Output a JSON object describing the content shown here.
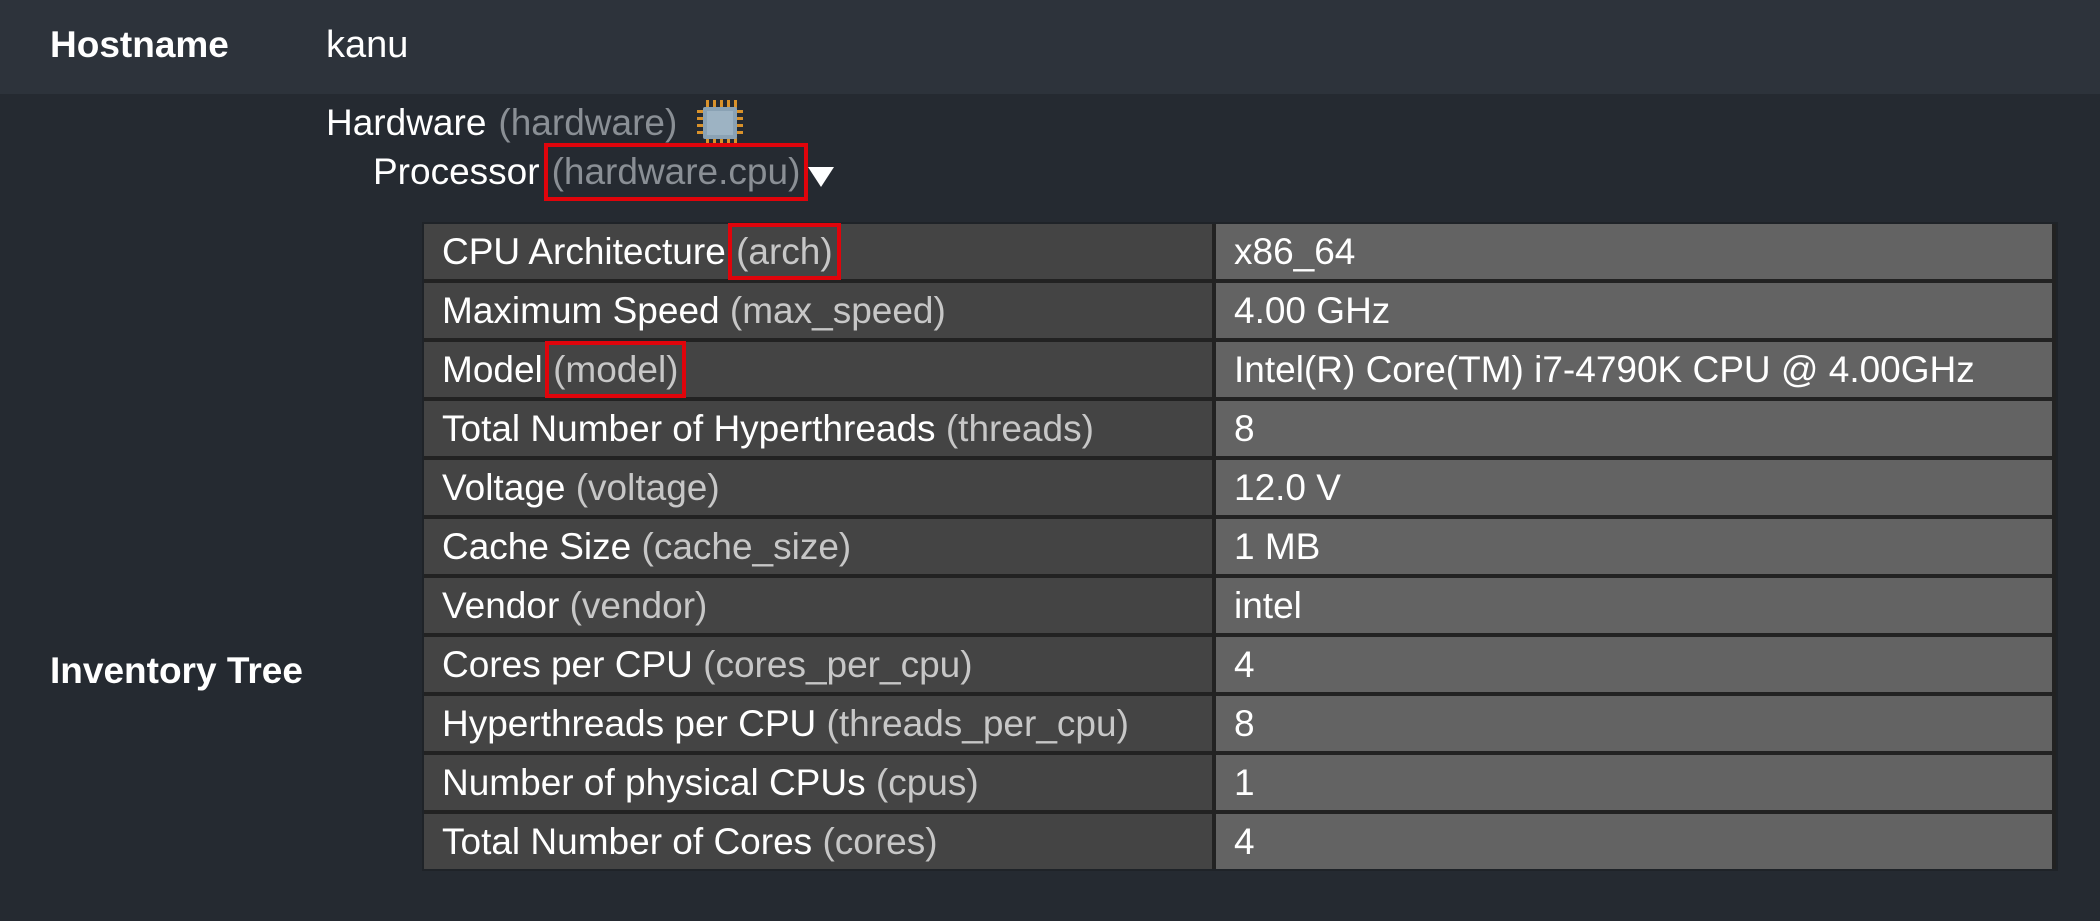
{
  "host": {
    "label": "Hostname",
    "value": "kanu"
  },
  "inventory": {
    "label": "Inventory Tree",
    "node": {
      "title": "Hardware",
      "path": "(hardware)",
      "icon": "cpu-chip-icon",
      "child": {
        "title": "Processor",
        "path": "(hardware.cpu)",
        "expand_icon": "triangle-down-icon"
      }
    },
    "rows": [
      {
        "name": "CPU Architecture",
        "key": "(arch)",
        "value": "x86_64"
      },
      {
        "name": "Maximum Speed",
        "key": "(max_speed)",
        "value": "4.00 GHz"
      },
      {
        "name": "Model",
        "key": "(model)",
        "value": "Intel(R) Core(TM) i7-4790K CPU @ 4.00GHz"
      },
      {
        "name": "Total Number of Hyperthreads",
        "key": "(threads)",
        "value": "8"
      },
      {
        "name": "Voltage",
        "key": "(voltage)",
        "value": "12.0 V"
      },
      {
        "name": "Cache Size",
        "key": "(cache_size)",
        "value": "1 MB"
      },
      {
        "name": "Vendor",
        "key": "(vendor)",
        "value": "intel"
      },
      {
        "name": "Cores per CPU",
        "key": "(cores_per_cpu)",
        "value": "4"
      },
      {
        "name": "Hyperthreads per CPU",
        "key": "(threads_per_cpu)",
        "value": "8"
      },
      {
        "name": "Number of physical CPUs",
        "key": "(cpus)",
        "value": "1"
      },
      {
        "name": "Total Number of Cores",
        "key": "(cores)",
        "value": "4"
      }
    ]
  },
  "colors": {
    "background": "#252a31",
    "header_row": "#2d333b",
    "key_cell": "#444444",
    "value_cell": "#636363",
    "highlight": "#e0040b"
  }
}
